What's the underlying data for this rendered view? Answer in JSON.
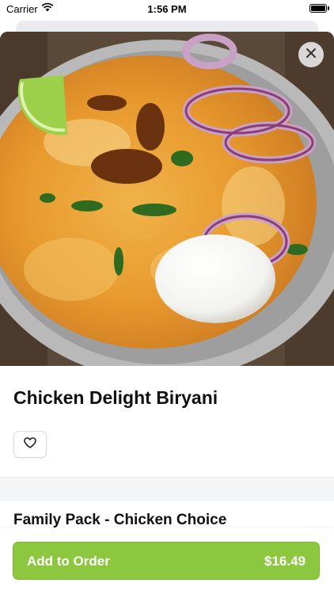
{
  "status_bar": {
    "carrier": "Carrier",
    "time": "1:56 PM"
  },
  "item": {
    "name": "Chicken Delight Biryani",
    "section_title": "Family Pack - Chicken Choice"
  },
  "footer": {
    "add_label": "Add to Order",
    "price": "$16.49"
  },
  "colors": {
    "accent": "#8dc63f",
    "divider_band": "#f4f5f7"
  },
  "icons": {
    "close": "close-icon",
    "favorite": "heart-icon",
    "wifi": "wifi-icon",
    "battery": "battery-icon"
  }
}
